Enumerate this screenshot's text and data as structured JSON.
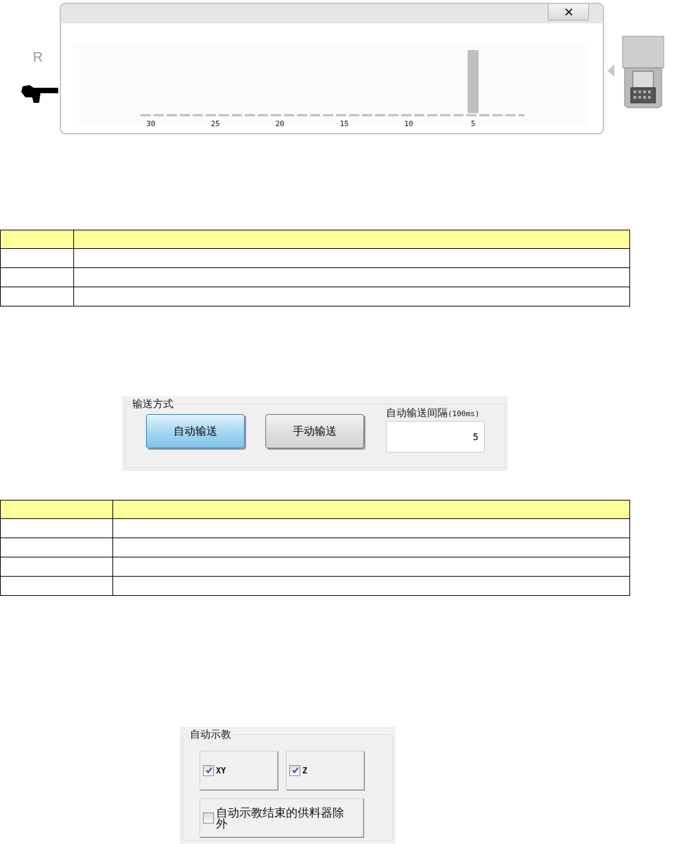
{
  "side_label": "R",
  "panel": {
    "close": "✕",
    "ticks": [
      {
        "label": "30",
        "bar": false
      },
      {
        "label": "25",
        "bar": false
      },
      {
        "label": "20",
        "bar": false
      },
      {
        "label": "15",
        "bar": false
      },
      {
        "label": "10",
        "bar": false
      },
      {
        "label": "5",
        "bar": true
      }
    ]
  },
  "transfer_group": {
    "title": "输送方式",
    "buttons": [
      {
        "label": "自动输送",
        "selected": true
      },
      {
        "label": "手动输送",
        "selected": false
      }
    ],
    "interval": {
      "label": "自动输送间隔",
      "unit": "(100ms)",
      "value": "5"
    }
  },
  "teach_group": {
    "title": "自动示教",
    "options": [
      {
        "label": "XY",
        "checked": true
      },
      {
        "label": "Z",
        "checked": true
      },
      {
        "label": "自动示教结束的供料器除外",
        "checked": false
      }
    ]
  }
}
